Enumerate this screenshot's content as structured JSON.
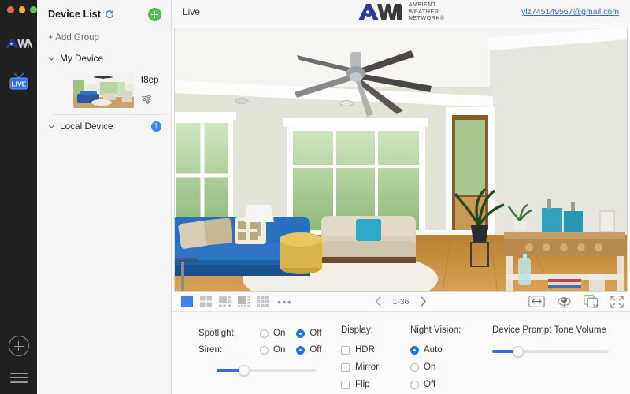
{
  "window": {
    "traffic_lights": [
      "close",
      "minimize",
      "maximize"
    ]
  },
  "rail": {
    "logo_label": "AWN",
    "live_label": "LIVE",
    "add_icon": "circle-plus-icon",
    "menu_icon": "hamburger-menu-icon"
  },
  "sidebar": {
    "title": "Device List",
    "refresh_icon": "refresh-icon",
    "add_button_icon": "plus-icon",
    "add_group_label": "+ Add Group",
    "groups": [
      {
        "label": "My Device",
        "expanded": true,
        "help": false
      },
      {
        "label": "Local Device",
        "expanded": true,
        "help": true,
        "help_label": "?"
      }
    ],
    "device": {
      "name": "t8ep",
      "settings_icon": "sliders-icon",
      "thumbnail_alt": "living-room-camera-thumbnail"
    }
  },
  "header": {
    "live_label": "Live",
    "brand": {
      "mark": "AWN",
      "line1": "AMBIENT",
      "line2": "WEATHER",
      "line3": "NETWORK®",
      "mark_color": "#2c3b8f",
      "wn_color": "#3a3a3a"
    },
    "account_email": "ylz745149567@gmail.com"
  },
  "video": {
    "alt": "live-camera-feed-living-room"
  },
  "toolbar": {
    "layouts": [
      {
        "name": "layout-1x1",
        "selected": true
      },
      {
        "name": "layout-2x2",
        "selected": false
      },
      {
        "name": "layout-1-plus-5",
        "selected": false
      },
      {
        "name": "layout-1-plus-7",
        "selected": false
      },
      {
        "name": "layout-3x3",
        "selected": false
      }
    ],
    "more_label": "•••",
    "prev_icon": "chevron-left-icon",
    "next_icon": "chevron-right-icon",
    "page_range": "1-36",
    "right_tools": [
      {
        "name": "aspect-ratio-icon"
      },
      {
        "name": "ptz-camera-icon"
      },
      {
        "name": "close-all-windows-icon"
      },
      {
        "name": "fullscreen-icon"
      }
    ]
  },
  "controls": {
    "spotlight": {
      "label": "Spotlight:",
      "options": [
        "On",
        "Off"
      ],
      "selected": "Off"
    },
    "siren": {
      "label": "Siren:",
      "options": [
        "On",
        "Off"
      ],
      "selected": "Off"
    },
    "siren_slider": {
      "value": 28
    },
    "display": {
      "label": "Display:",
      "items": [
        {
          "label": "HDR",
          "checked": false
        },
        {
          "label": "Mirror",
          "checked": false
        },
        {
          "label": "Flip",
          "checked": false
        }
      ]
    },
    "night_vision": {
      "label": "Night Vision:",
      "options": [
        "Auto",
        "On",
        "Off"
      ],
      "selected": "Auto"
    },
    "volume": {
      "label": "Device Prompt Tone Volume",
      "value": 22
    }
  },
  "colors": {
    "accent_blue": "#1d74e8",
    "slider_blue": "#2f6fe0",
    "add_green": "#4bc14b",
    "link_blue": "#2f6bd1",
    "rail_bg": "#202020"
  }
}
